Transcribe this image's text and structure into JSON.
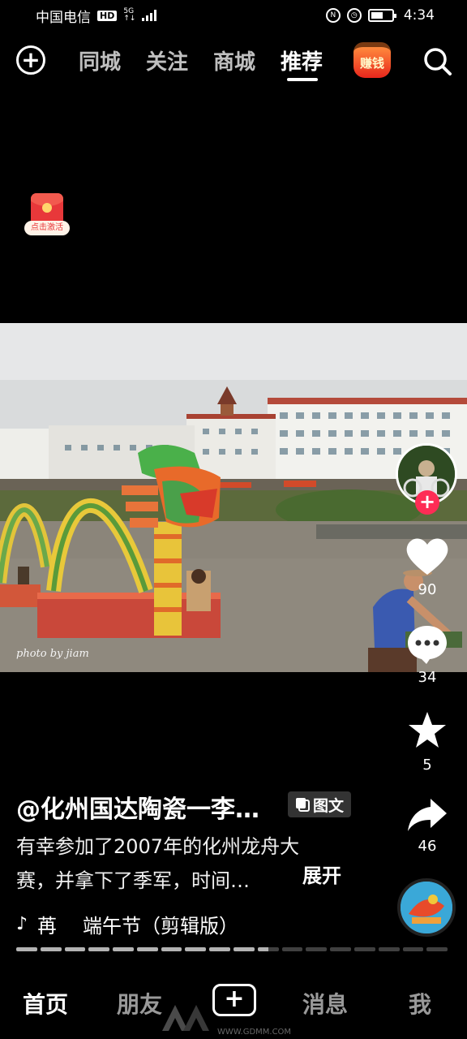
{
  "status_bar": {
    "carrier": "中国电信",
    "hd": "HD",
    "network": "5G",
    "time": "4:34"
  },
  "top_nav": {
    "tabs": [
      {
        "label": "同城",
        "active": false
      },
      {
        "label": "关注",
        "active": false
      },
      {
        "label": "商城",
        "active": false
      },
      {
        "label": "推荐",
        "active": true
      }
    ],
    "earn_label": "赚钱",
    "icons": [
      "plus-circle-icon",
      "search-icon"
    ]
  },
  "red_packet": {
    "label": "点击激活"
  },
  "video": {
    "watermark": "photo by jiam"
  },
  "actions": {
    "likes": "90",
    "comments": "34",
    "favorites": "5",
    "shares": "46"
  },
  "post": {
    "author": "@化州国达陶瓷一李…",
    "type_label": "图文",
    "description_line1": "有幸参加了2007年的化州龙舟大",
    "description_line2": "赛，并拿下了季军，时间…",
    "expand_label": "展开",
    "music_artist": "苒",
    "music_title": "端午节（剪辑版）",
    "progress": {
      "total_segments": 18,
      "completed_segments": 10.5
    }
  },
  "bottom_nav": {
    "items": [
      {
        "label": "首页",
        "active": true
      },
      {
        "label": "朋友",
        "active": false
      },
      {
        "label": "消息",
        "active": false
      },
      {
        "label": "我",
        "active": false
      }
    ]
  },
  "site_watermark": "WWW.GDMM.COM",
  "colors": {
    "accent": "#fe2c55",
    "background": "#000000"
  }
}
